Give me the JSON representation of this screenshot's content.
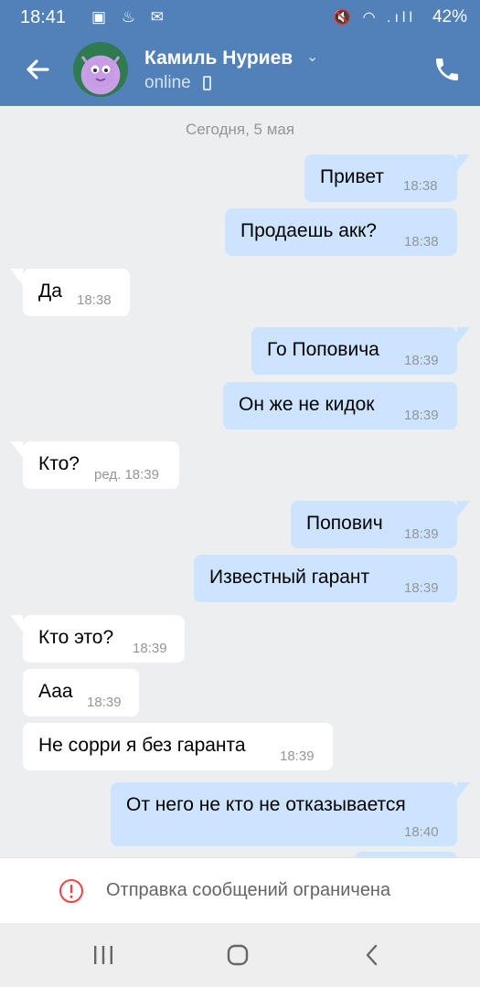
{
  "status_bar": {
    "time": "18:41",
    "left_icons": "▣ ♨ ✉",
    "right_icons": "🔇 ◠ .ıll",
    "battery": "42%"
  },
  "header": {
    "contact_name": "Камиль Нуриев",
    "status": "online",
    "chevron": "⌄"
  },
  "date_separator": "Сегодня, 5 мая",
  "messages": [
    {
      "text": "Привет",
      "time": "18:38",
      "dir": "out"
    },
    {
      "text": "Продаешь акк?",
      "time": "18:38",
      "dir": "out"
    },
    {
      "text": "Да",
      "time": "18:38",
      "dir": "in"
    },
    {
      "text": "Го Поповича",
      "time": "18:39",
      "dir": "out"
    },
    {
      "text": "Он же не кидок",
      "time": "18:39",
      "dir": "out"
    },
    {
      "text": "Кто?",
      "time": "ред. 18:39",
      "dir": "in"
    },
    {
      "text": "Попович",
      "time": "18:39",
      "dir": "out"
    },
    {
      "text": "Известный гарант",
      "time": "18:39",
      "dir": "out"
    },
    {
      "text": "Кто это?",
      "time": "18:39",
      "dir": "in"
    },
    {
      "text": "Ааа",
      "time": "18:39",
      "dir": "in"
    },
    {
      "text": "Не сорри я без гаранта",
      "time": "18:39",
      "dir": "in"
    },
    {
      "text": "От него не кто не отказывается",
      "time": "18:40",
      "dir": "out"
    }
  ],
  "restriction": {
    "text": "Отправка сообщений ограничена",
    "icon": "alert-icon"
  },
  "colors": {
    "header_bg": "#5181b8",
    "outgoing_bubble": "#cce4ff",
    "incoming_bubble": "#ffffff",
    "chat_bg": "#edeef0",
    "alert_red": "#e64646"
  }
}
